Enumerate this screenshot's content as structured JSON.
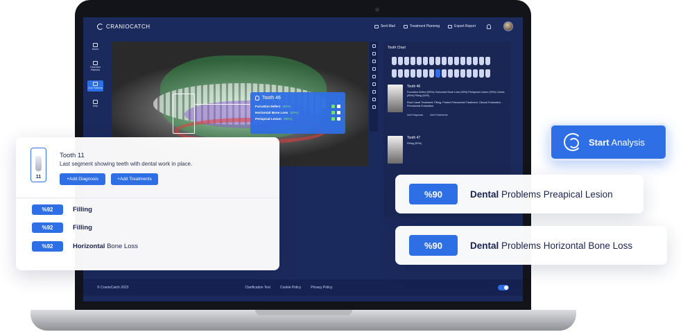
{
  "app": {
    "brand": "CRANIOCATCH",
    "nav": [
      "Sent Mail",
      "Treatment Planning",
      "Export Report"
    ]
  },
  "sidebar": {
    "items": [
      {
        "label": "Home"
      },
      {
        "label": "Parented Patients"
      },
      {
        "label": "Add Patients"
      },
      {
        "label": "Help"
      }
    ]
  },
  "viewer": {
    "popup_title": "Tooth 46",
    "findings": [
      {
        "label": "Furcation Defect",
        "pct": "(95%)"
      },
      {
        "label": "Horizontal Bone Loss",
        "pct": "(90%)"
      },
      {
        "label": "Periapical Lesion",
        "pct": "(90%)"
      }
    ]
  },
  "tooth_chart": {
    "title": "Tooth Chart",
    "cards": [
      {
        "title": "Tooth 46",
        "line1": "Furcation Defect (95%) Horizontal Bone Loss (90%) Periapical Lesion (90%) Caries (90%) Filling (92%)",
        "line2": "Root Canal Treatment, Filling, Protect Periodontal Treatment, Clinical Evaluation, Periodontal Evaluation",
        "add_diagnosis": "Add Diagnosis",
        "add_treatments": "Add Treatments"
      },
      {
        "title": "Tooth 47",
        "line1": "Filling (90%)",
        "line2": "",
        "add_diagnosis": "",
        "add_treatments": ""
      }
    ]
  },
  "footer": {
    "copyright": "© CranioCatch 2023",
    "links": [
      "Clarification Text",
      "Cookie Policy",
      "Privacy Policy"
    ]
  },
  "left_card": {
    "tooth_number": "11",
    "title": "Tooth 11",
    "description": "Last segment showing teeth with dental work in place.",
    "add_diagnosis": "+Add Diagnosis",
    "add_treatments": "+Add Treatments",
    "rows": [
      {
        "pct": "%92",
        "bold": "Filling",
        "rest": ""
      },
      {
        "pct": "%92",
        "bold": "Filling",
        "rest": ""
      },
      {
        "pct": "%92",
        "bold": "Horizontal",
        "rest": " Bone Loss"
      }
    ]
  },
  "start": {
    "bold": "Start",
    "rest": " Analysis"
  },
  "problems": [
    {
      "pct": "%90",
      "bold": "Dental",
      "rest": " Problems Preapical Lesion"
    },
    {
      "pct": "%90",
      "bold": "Dental",
      "rest": " Problems Horizontal Bone Loss"
    }
  ],
  "colors": {
    "accent": "#2f6fe5",
    "screen_bg": "#1b2a5c",
    "text_dark": "#1b2350"
  }
}
